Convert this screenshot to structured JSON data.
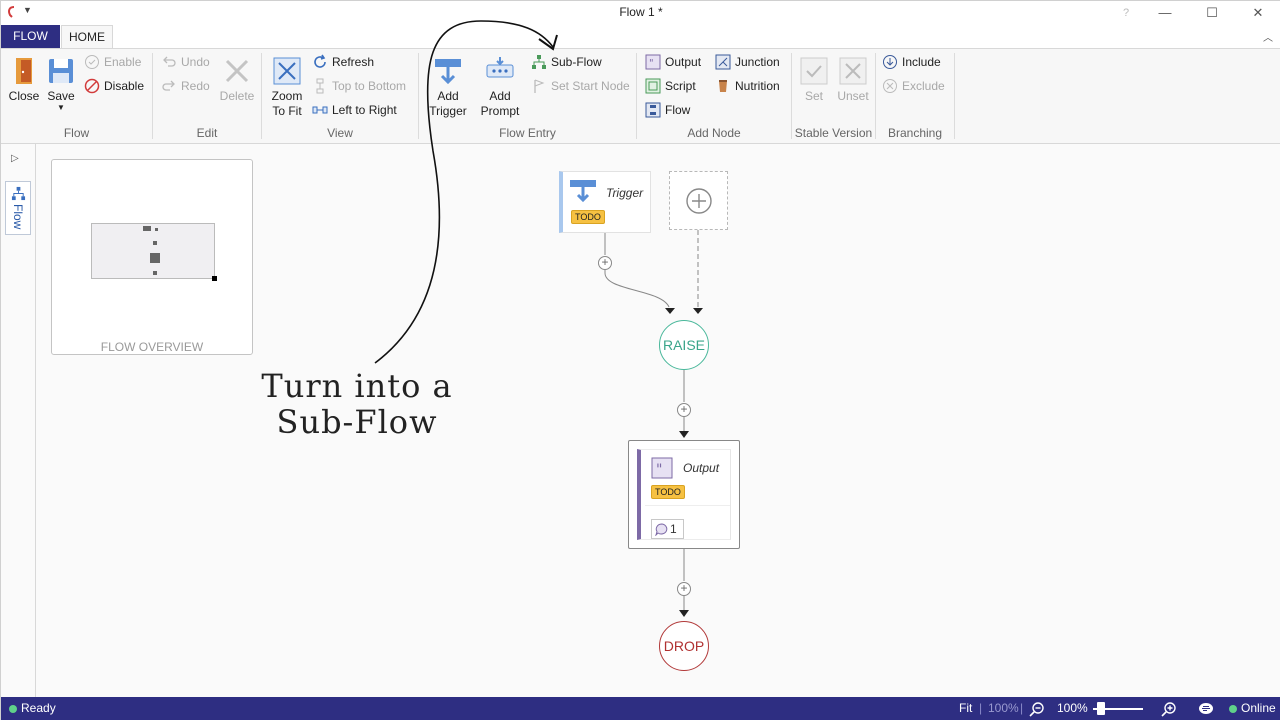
{
  "window": {
    "title": "Flow 1 *",
    "controls": {
      "help": "?",
      "minimize": "—",
      "maximize": "☐",
      "close": "✕"
    }
  },
  "tabs": [
    {
      "label": "FLOW",
      "active": false
    },
    {
      "label": "HOME",
      "active": true
    }
  ],
  "ribbon": {
    "flow_group": {
      "label": "Flow",
      "close": "Close",
      "save": "Save",
      "enable": "Enable",
      "disable": "Disable"
    },
    "edit_group": {
      "label": "Edit",
      "undo": "Undo",
      "redo": "Redo",
      "delete": "Delete"
    },
    "view_group": {
      "label": "View",
      "zoom_to_fit_1": "Zoom",
      "zoom_to_fit_2": "To Fit",
      "refresh": "Refresh",
      "top_to_bottom": "Top to Bottom",
      "left_to_right": "Left to Right"
    },
    "flow_entry_group": {
      "label": "Flow Entry",
      "add_trigger_1": "Add",
      "add_trigger_2": "Trigger",
      "add_prompt_1": "Add",
      "add_prompt_2": "Prompt",
      "sub_flow": "Sub-Flow",
      "set_start_node": "Set Start Node"
    },
    "add_node_group": {
      "label": "Add Node",
      "output": "Output",
      "junction": "Junction",
      "script": "Script",
      "nutrition": "Nutrition",
      "flow": "Flow"
    },
    "stable_version_group": {
      "label": "Stable Version",
      "set": "Set",
      "unset": "Unset"
    },
    "branching_group": {
      "label": "Branching",
      "include": "Include",
      "exclude": "Exclude"
    }
  },
  "dock": {
    "tab_label": "Flow"
  },
  "overview": {
    "label": "FLOW OVERVIEW"
  },
  "nodes": {
    "trigger": {
      "title": "Trigger",
      "badge": "TODO"
    },
    "raise": {
      "label": "RAISE"
    },
    "output": {
      "title": "Output",
      "badge": "TODO",
      "comment_count": "1"
    },
    "drop": {
      "label": "DROP"
    }
  },
  "annotation": {
    "line1": "Turn into a",
    "line2": "Sub-Flow"
  },
  "statusbar": {
    "status": "Ready",
    "fit": "Fit",
    "zoom_preset": "100%",
    "zoom_level": "100%",
    "connection": "Online"
  },
  "colors": {
    "accent": "#2e2e82",
    "raise": "#3aa58a",
    "drop": "#b03030",
    "todo": "#f6c142",
    "output_bar": "#7d6aa6"
  }
}
